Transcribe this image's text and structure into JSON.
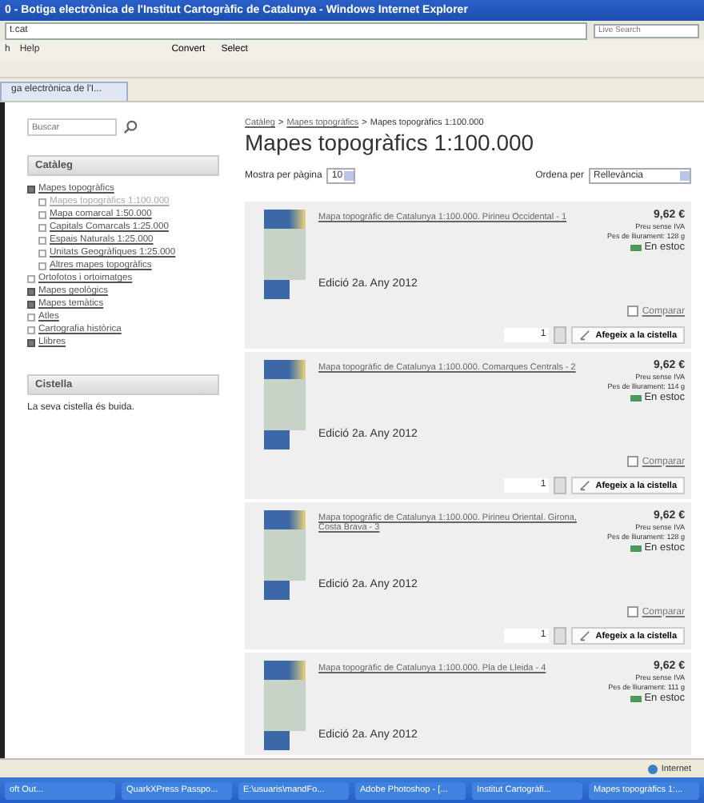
{
  "window": {
    "title": "0 - Botiga electrònica de l'Institut Cartogràfic de Catalunya - Windows Internet Explorer"
  },
  "address_bar": {
    "value": "t.cat",
    "search_placeholder": "Live Search"
  },
  "menu": {
    "items": [
      "h",
      "Help"
    ]
  },
  "toolbar": {
    "buttons": [
      "Convert",
      "Select"
    ]
  },
  "tab": {
    "label": "ga electrònica de l'I..."
  },
  "sidebar": {
    "search": {
      "placeholder": "Buscar"
    },
    "catalog": {
      "title": "Catàleg",
      "items": [
        {
          "label": "Mapes topogràfics",
          "expandable": true,
          "children": [
            {
              "label": "Mapes topogràfics 1:100.000",
              "selected": true
            },
            {
              "label": "Mapa comarcal 1:50.000",
              "selected": false
            },
            {
              "label": "Capitals Comarcals 1:25.000",
              "selected": false
            },
            {
              "label": "Espais Naturals 1:25.000",
              "selected": false
            },
            {
              "label": "Unitats Geogràfiques 1:25.000",
              "selected": false
            },
            {
              "label": "Altres mapes topogràfics",
              "selected": false
            }
          ]
        },
        {
          "label": "Ortofotos i ortoimatges",
          "expandable": false
        },
        {
          "label": "Mapes geològics",
          "expandable": true
        },
        {
          "label": "Mapes temàtics",
          "expandable": true
        },
        {
          "label": "Atles",
          "expandable": false
        },
        {
          "label": "Cartografia històrica",
          "expandable": false
        },
        {
          "label": "Llibres",
          "expandable": true
        }
      ]
    },
    "basket": {
      "title": "Cistella",
      "text": "La seva cistella és buida."
    }
  },
  "main": {
    "breadcrumb": [
      {
        "label": "Catàleg"
      },
      {
        "separator": ">",
        "label": "Mapes topogràfics"
      },
      {
        "separator": ">",
        "label": "Mapes topogràfics 1:100.000"
      }
    ],
    "heading": "Mapes topogràfics 1:100.000",
    "per_page": {
      "label": "Mostra per pàgina",
      "value": "10"
    },
    "sort": {
      "label": "Ordena per",
      "value": "Rellevància"
    },
    "products": [
      {
        "title": "Mapa topogràfic de Catalunya 1:100.000. Pirineu Occidental - 1",
        "edition": "Edició 2a. Any 2012",
        "price": "9,62 €",
        "tax": "Preu sense IVA",
        "weight": "Pes de lliurament: 128 g",
        "stock": "En estoc",
        "compare": {
          "label": "Comparar",
          "checked": false
        },
        "quantity": "1",
        "add": "Afegeix a la cistella"
      },
      {
        "title": "Mapa topogràfic de Catalunya 1:100.000. Comarques Centrals - 2",
        "edition": "Edició 2a. Any 2012",
        "price": "9,62 €",
        "tax": "Preu sense IVA",
        "weight": "Pes de lliurament: 114 g",
        "stock": "En estoc",
        "compare": {
          "label": "Comparar",
          "checked": false
        },
        "quantity": "1",
        "add": "Afegeix a la cistella"
      },
      {
        "title": "Mapa topogràfic de Catalunya 1:100.000. Pirineu Oriental. Girona, Costa Brava - 3",
        "edition": "Edició 2a. Any 2012",
        "price": "9,62 €",
        "tax": "Preu sense IVA",
        "weight": "Pes de lliurament: 128 g",
        "stock": "En estoc",
        "compare": {
          "label": "Comparar",
          "checked": false
        },
        "quantity": "1",
        "add": "Afegeix a la cistella"
      },
      {
        "title": "Mapa topogràfic de Catalunya 1:100.000. Pla de Lleida - 4",
        "edition": "Edició 2a. Any 2012",
        "price": "9,62 €",
        "tax": "Preu sense IVA",
        "weight": "Pes de lliurament: 111 g",
        "stock": "En estoc"
      }
    ]
  },
  "status_bar": {
    "zone": "Internet"
  },
  "taskbar": {
    "items": [
      "oft Out...",
      "QuarkXPress Passpo...",
      "E:\\usuaris\\mandFo...",
      "Adobe Photoshop - [...",
      "Institut Cartogràfi...",
      "Mapes topogràfics 1:..."
    ]
  }
}
